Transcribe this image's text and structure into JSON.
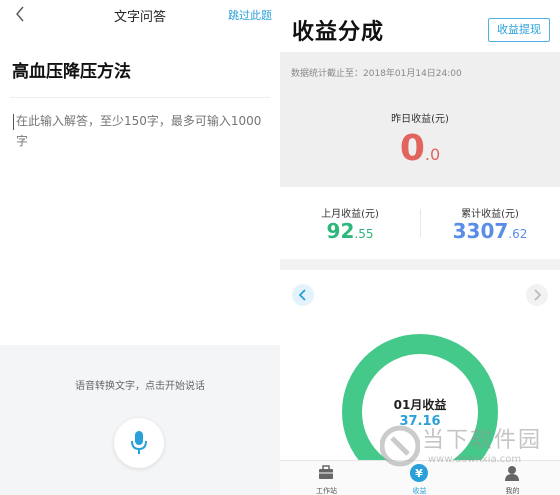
{
  "left": {
    "topbar": {
      "title": "文字问答",
      "skip": "跳过此题"
    },
    "question_title": "高血压降压方法",
    "answer": {
      "value": "",
      "placeholder": "在此输入解答，至少150字，最多可输入1000字"
    },
    "voice": {
      "hint": "语音转换文字，点击开始说话"
    }
  },
  "right": {
    "title": "收益分成",
    "withdraw_label": "收益提现",
    "stats_date": "数据统计截止至：2018年01月14日24:00",
    "yesterday": {
      "label": "昨日收益(元)",
      "int": "0",
      "dec": ".0"
    },
    "last_month": {
      "label": "上月收益(元)",
      "int": "92",
      "dec": ".55"
    },
    "total": {
      "label": "累计收益(元)",
      "int": "3307",
      "dec": ".62"
    },
    "gauge": {
      "label": "01月收益",
      "value": "37.16"
    },
    "nav": [
      {
        "label": "工作站",
        "icon": "briefcase-icon",
        "active": false
      },
      {
        "label": "收益",
        "icon": "yen-icon",
        "active": true
      },
      {
        "label": "我的",
        "icon": "person-icon",
        "active": false
      }
    ]
  },
  "watermark": {
    "text": "当下软件园",
    "url": "www.downxia.com"
  },
  "colors": {
    "accent": "#2aa0d8",
    "green": "#2db77b",
    "red": "#e2645f",
    "blue": "#5a8de6"
  }
}
